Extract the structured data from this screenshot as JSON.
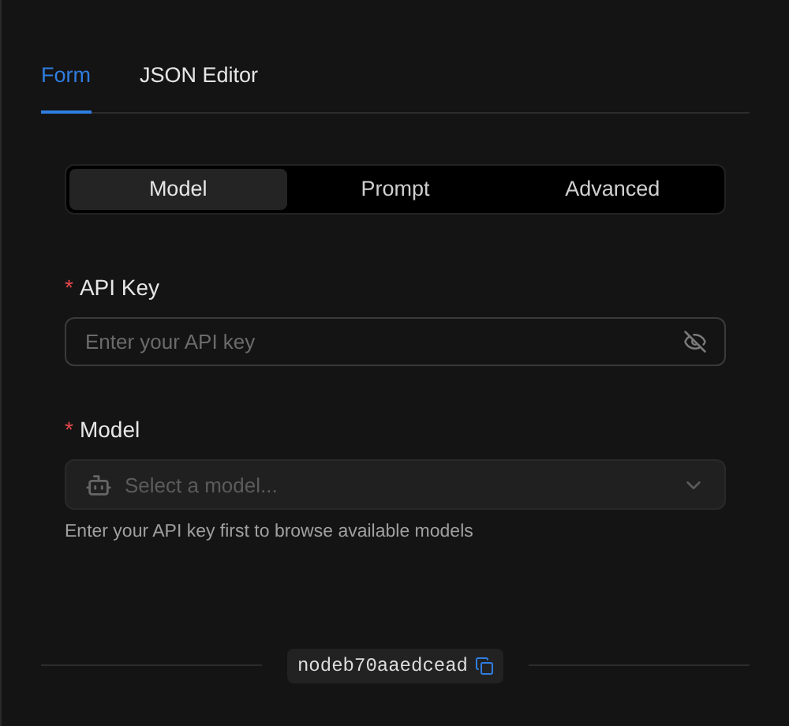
{
  "tabs": [
    {
      "label": "Form",
      "selected": true
    },
    {
      "label": "JSON Editor",
      "selected": false
    }
  ],
  "segments": [
    {
      "label": "Model",
      "selected": true
    },
    {
      "label": "Prompt",
      "selected": false
    },
    {
      "label": "Advanced",
      "selected": false
    }
  ],
  "fields": [
    {
      "kind": "password",
      "label": "API Key",
      "required": true,
      "required_mark": "*",
      "placeholder": "Enter your API key"
    },
    {
      "kind": "select",
      "label": "Model",
      "required": true,
      "required_mark": "*",
      "placeholder": "Select a model...",
      "disabled": true,
      "help": "Enter your API key first to browse available models"
    }
  ],
  "footer": {
    "node_id": "nodeb70aaedcead"
  }
}
